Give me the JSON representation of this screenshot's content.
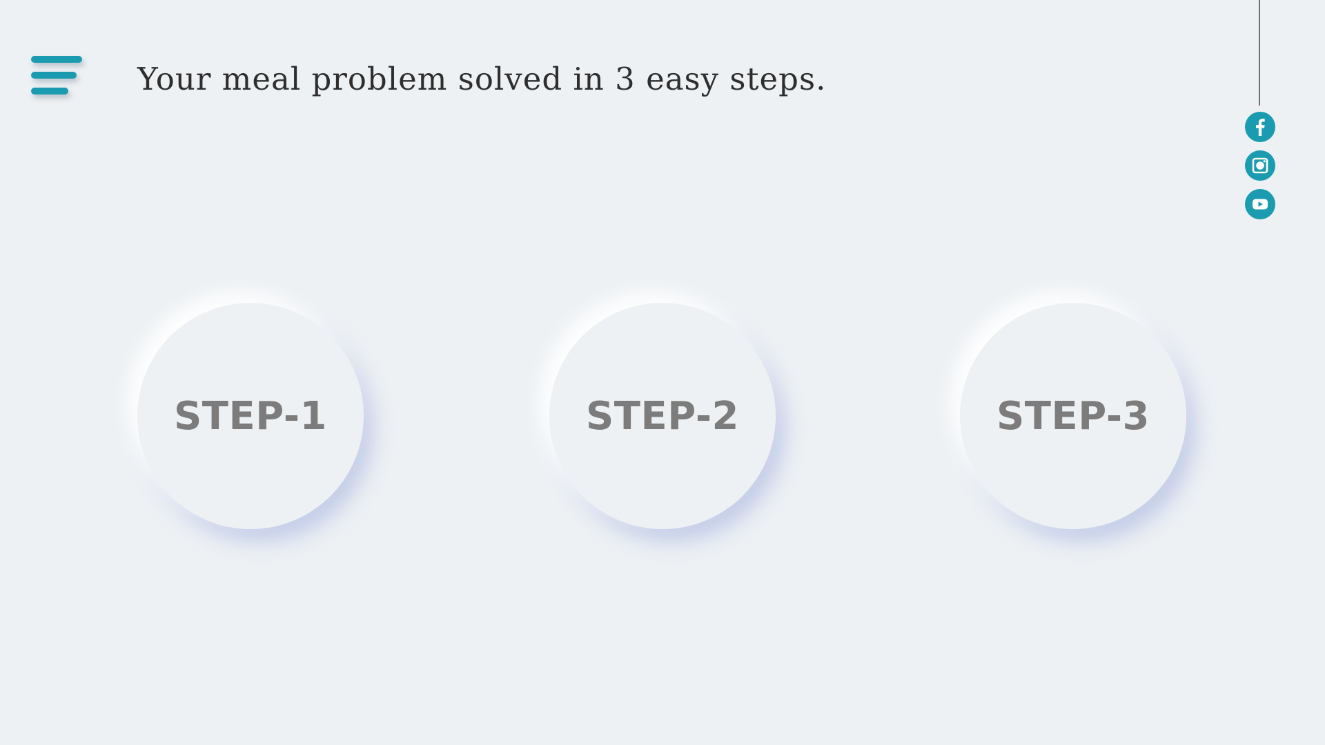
{
  "header": {
    "headline": "Your meal problem solved in 3 easy steps."
  },
  "menu": {
    "icon": "hamburger-menu-icon"
  },
  "social": {
    "icons": [
      "facebook-icon",
      "instagram-icon",
      "youtube-icon"
    ],
    "color": "#1a9bb0"
  },
  "steps": [
    {
      "label": "STEP-1"
    },
    {
      "label": "STEP-2"
    },
    {
      "label": "STEP-3"
    }
  ],
  "colors": {
    "accent": "#1a9bb0",
    "background": "#edf1f4",
    "step_text": "#7c7c7c",
    "headline_text": "#2e2e2e"
  }
}
